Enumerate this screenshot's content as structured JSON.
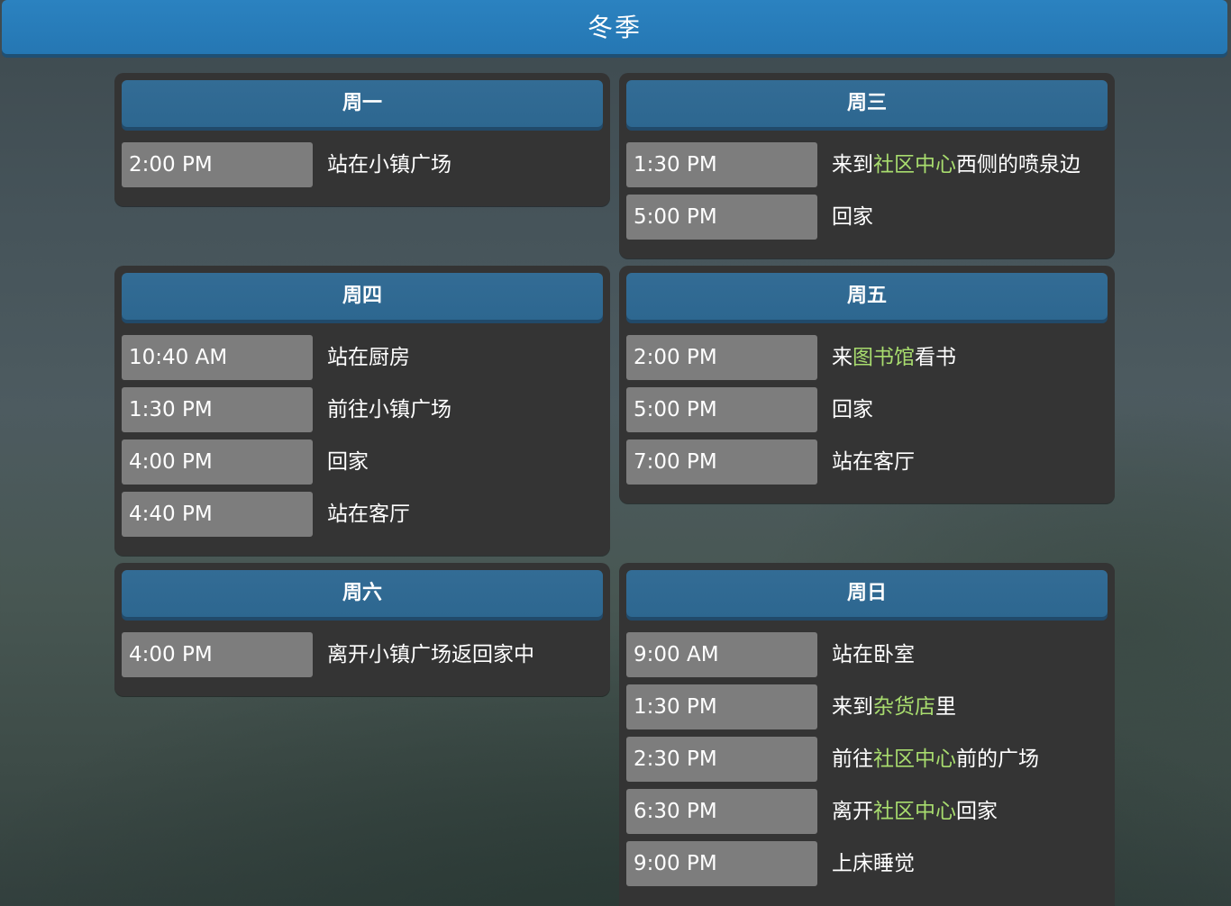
{
  "season": "冬季",
  "colors": {
    "highlight": "#a8dc6e",
    "header": "#2577b3",
    "day_header": "#2d6790"
  },
  "days": {
    "mon": {
      "name": "周一",
      "entries": [
        {
          "time": "2:00 PM",
          "parts": [
            {
              "text": "站在小镇广场"
            }
          ]
        }
      ]
    },
    "wed": {
      "name": "周三",
      "entries": [
        {
          "time": "1:30 PM",
          "parts": [
            {
              "text": "来到"
            },
            {
              "text": "社区中心",
              "hl": true
            },
            {
              "text": "西侧的喷泉边"
            }
          ]
        },
        {
          "time": "5:00 PM",
          "parts": [
            {
              "text": "回家"
            }
          ]
        }
      ]
    },
    "thu": {
      "name": "周四",
      "entries": [
        {
          "time": "10:40 AM",
          "parts": [
            {
              "text": "站在厨房"
            }
          ]
        },
        {
          "time": "1:30 PM",
          "parts": [
            {
              "text": "前往小镇广场"
            }
          ]
        },
        {
          "time": "4:00 PM",
          "parts": [
            {
              "text": "回家"
            }
          ]
        },
        {
          "time": "4:40 PM",
          "parts": [
            {
              "text": "站在客厅"
            }
          ]
        }
      ]
    },
    "fri": {
      "name": "周五",
      "entries": [
        {
          "time": "2:00 PM",
          "parts": [
            {
              "text": "来"
            },
            {
              "text": "图书馆",
              "hl": true
            },
            {
              "text": "看书"
            }
          ]
        },
        {
          "time": "5:00 PM",
          "parts": [
            {
              "text": "回家"
            }
          ]
        },
        {
          "time": "7:00 PM",
          "parts": [
            {
              "text": "站在客厅"
            }
          ]
        }
      ]
    },
    "sat": {
      "name": "周六",
      "entries": [
        {
          "time": "4:00 PM",
          "parts": [
            {
              "text": "离开小镇广场返回家中"
            }
          ]
        }
      ]
    },
    "sun": {
      "name": "周日",
      "entries": [
        {
          "time": "9:00 AM",
          "parts": [
            {
              "text": "站在卧室"
            }
          ]
        },
        {
          "time": "1:30 PM",
          "parts": [
            {
              "text": "来到"
            },
            {
              "text": "杂货店",
              "hl": true
            },
            {
              "text": "里"
            }
          ]
        },
        {
          "time": "2:30 PM",
          "parts": [
            {
              "text": "前往"
            },
            {
              "text": "社区中心",
              "hl": true
            },
            {
              "text": "前的广场"
            }
          ]
        },
        {
          "time": "6:30 PM",
          "parts": [
            {
              "text": "离开"
            },
            {
              "text": "社区中心",
              "hl": true
            },
            {
              "text": "回家"
            }
          ]
        },
        {
          "time": "9:00 PM",
          "parts": [
            {
              "text": "上床睡觉"
            }
          ]
        }
      ]
    }
  }
}
